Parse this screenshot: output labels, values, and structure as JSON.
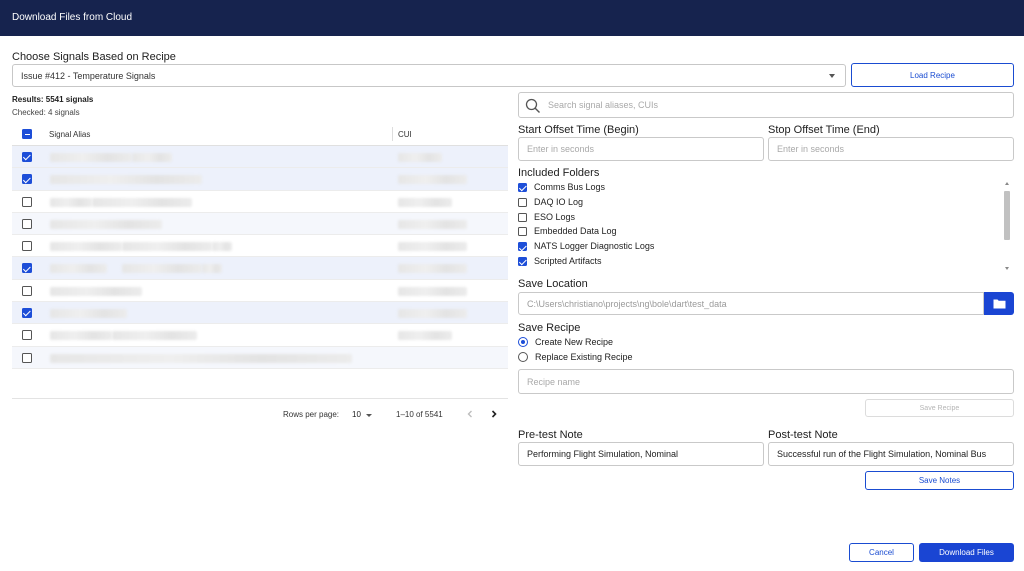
{
  "header": {
    "title": "Download Files from Cloud"
  },
  "recipe": {
    "label": "Choose Signals Based on Recipe",
    "selected": "Issue #412 - Temperature Signals",
    "load_button": "Load Recipe"
  },
  "results": {
    "count_text": "Results: 5541 signals",
    "checked_text": "Checked: 4 signals"
  },
  "search": {
    "placeholder": "Search signal aliases, CUIs"
  },
  "table": {
    "columns": {
      "alias": "Signal Alias",
      "cui": "CUI"
    },
    "header_checkbox": "indeterminate",
    "rows": [
      {
        "checked": true
      },
      {
        "checked": true
      },
      {
        "checked": false
      },
      {
        "checked": false
      },
      {
        "checked": false
      },
      {
        "checked": true
      },
      {
        "checked": false
      },
      {
        "checked": true
      },
      {
        "checked": false
      },
      {
        "checked": false
      }
    ],
    "pagination": {
      "rows_per_page_label": "Rows per page:",
      "rows_per_page_value": "10",
      "range_text": "1–10 of 5541"
    }
  },
  "offsets": {
    "start_label": "Start Offset Time (Begin)",
    "start_placeholder": "Enter in seconds",
    "stop_label": "Stop Offset Time (End)",
    "stop_placeholder": "Enter in seconds"
  },
  "folders": {
    "label": "Included Folders",
    "items": [
      {
        "label": "Comms Bus Logs",
        "checked": true
      },
      {
        "label": "DAQ IO Log",
        "checked": false
      },
      {
        "label": "ESO Logs",
        "checked": false
      },
      {
        "label": "Embedded Data Log",
        "checked": false
      },
      {
        "label": "NATS Logger Diagnostic Logs",
        "checked": true
      },
      {
        "label": "Scripted Artifacts",
        "checked": true
      }
    ]
  },
  "save_location": {
    "label": "Save Location",
    "value": "C:\\Users\\christiano\\projects\\ng\\bole\\dart\\test_data"
  },
  "save_recipe": {
    "label": "Save Recipe",
    "options": [
      {
        "label": "Create New Recipe",
        "selected": true
      },
      {
        "label": "Replace Existing Recipe",
        "selected": false
      }
    ],
    "name_placeholder": "Recipe name",
    "save_button": "Save Recipe"
  },
  "notes": {
    "pre_label": "Pre-test Note",
    "pre_value": "Performing Flight Simulation, Nominal",
    "post_label": "Post-test Note",
    "post_value": "Successful run of the Flight Simulation, Nominal Bus",
    "save_button": "Save Notes"
  },
  "footer": {
    "cancel": "Cancel",
    "download": "Download Files"
  },
  "colors": {
    "header_bg": "#16234e",
    "accent": "#1a45d3"
  }
}
